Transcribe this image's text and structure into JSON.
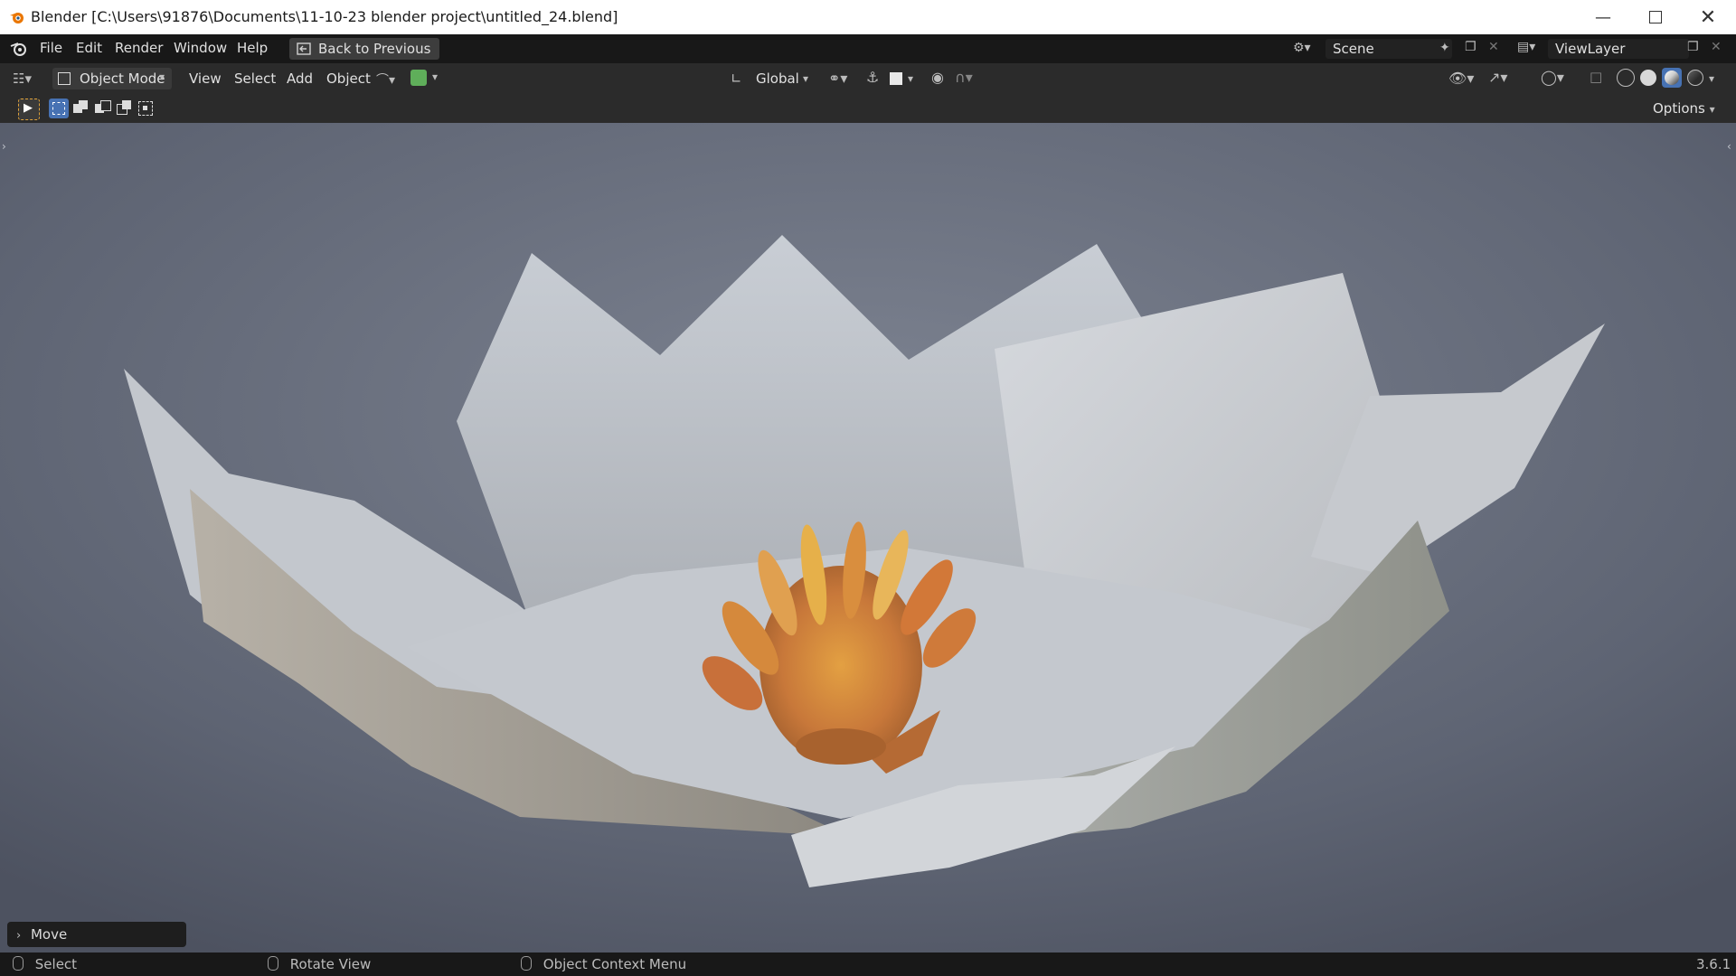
{
  "window": {
    "title": "Blender [C:\\Users\\91876\\Documents\\11-10-23 blender project\\untitled_24.blend]",
    "minimize_icon": "minimize-icon",
    "maximize_icon": "maximize-icon",
    "close_icon": "close-icon"
  },
  "topbar": {
    "menu": [
      "File",
      "Edit",
      "Render",
      "Window",
      "Help"
    ],
    "back_label": "Back to Previous",
    "scene_label": "Scene",
    "viewlayer_label": "ViewLayer"
  },
  "header": {
    "mode_label": "Object Mode",
    "menus": [
      "View",
      "Select",
      "Add",
      "Object"
    ],
    "transform_orientation": "Global",
    "options_label": "Options"
  },
  "operator_panel": {
    "label": "Move"
  },
  "statusbar": {
    "left_label": "Select",
    "middle_label": "Rotate View",
    "right_label": "Object Context Menu",
    "version": "3.6.1"
  },
  "colors": {
    "accent_blue": "#4772b3",
    "snap_green": "#5fae5a",
    "header_bg": "#2b2b2b",
    "topbar_bg": "#181818"
  }
}
